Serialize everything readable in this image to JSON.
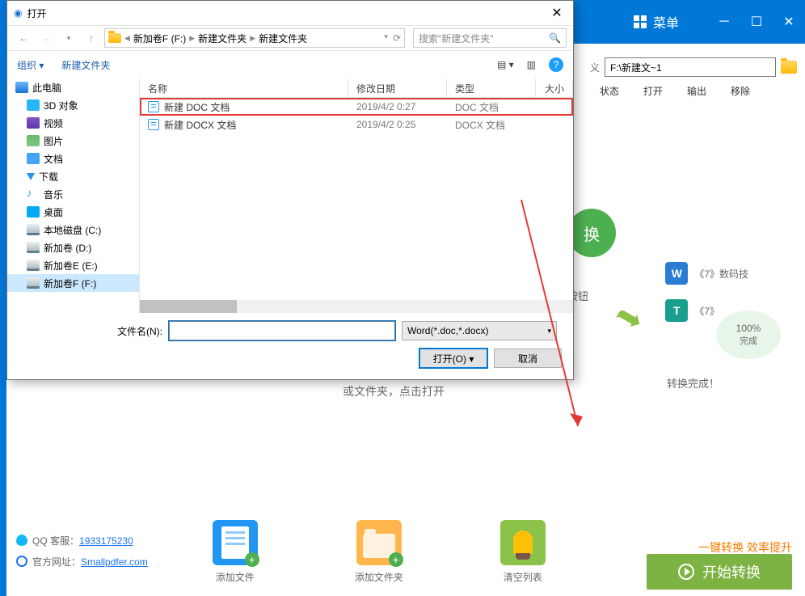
{
  "app": {
    "menu": "菜单",
    "path_value": "F:\\新建文~1",
    "columns": {
      "status": "状态",
      "open": "打开",
      "output": "输出",
      "remove": "移除"
    },
    "hint": "按钮",
    "sub": "或文件夹，点击打开",
    "convert_badge": "换",
    "widgets": [
      {
        "icon": "W",
        "label": "《7》数码技"
      },
      {
        "icon": "T",
        "label": "《7》"
      }
    ],
    "complete": {
      "pct": "100%",
      "txt": "完成"
    },
    "done": "转换完成！"
  },
  "footer": {
    "qq_label": "QQ 客服：",
    "qq_num": "1933175230",
    "site_label": "官方网址：",
    "site_url": "Smallpdfer.com",
    "actions": {
      "add_file": "添加文件",
      "add_folder": "添加文件夹",
      "clear": "清空列表"
    },
    "promo": "一键转换  效率提升",
    "start": "开始转换"
  },
  "dialog": {
    "title": "打开",
    "crumbs": [
      "新加卷F (F:)",
      "新建文件夹",
      "新建文件夹"
    ],
    "search_ph": "搜索\"新建文件夹\"",
    "toolbar": {
      "org": "组织",
      "newfolder": "新建文件夹",
      "views": [
        "",
        ""
      ]
    },
    "sidebar": [
      {
        "label": "此电脑",
        "icon": "icon-pc",
        "root": true
      },
      {
        "label": "3D 对象",
        "icon": "icon-3d"
      },
      {
        "label": "视频",
        "icon": "icon-video"
      },
      {
        "label": "图片",
        "icon": "icon-image"
      },
      {
        "label": "文档",
        "icon": "icon-doc"
      },
      {
        "label": "下载",
        "icon": "icon-download"
      },
      {
        "label": "音乐",
        "icon": "icon-music",
        "glyph": "♪"
      },
      {
        "label": "桌面",
        "icon": "icon-desktop"
      },
      {
        "label": "本地磁盘 (C:)",
        "icon": "icon-disk"
      },
      {
        "label": "新加卷 (D:)",
        "icon": "icon-disk"
      },
      {
        "label": "新加卷E (E:)",
        "icon": "icon-disk"
      },
      {
        "label": "新加卷F (F:)",
        "icon": "icon-disk",
        "selected": true
      }
    ],
    "columns": {
      "name": "名称",
      "date": "修改日期",
      "type": "类型",
      "size": "大小"
    },
    "files": [
      {
        "name": "新建 DOC 文档",
        "date": "2019/4/2 0:27",
        "type": "DOC 文档",
        "hl": true
      },
      {
        "name": "新建 DOCX 文档",
        "date": "2019/4/2 0:25",
        "type": "DOCX 文档",
        "hl": false
      }
    ],
    "filename_label": "文件名(N):",
    "filter": "Word(*.doc,*.docx)",
    "open_btn": "打开(O)",
    "cancel_btn": "取消"
  }
}
